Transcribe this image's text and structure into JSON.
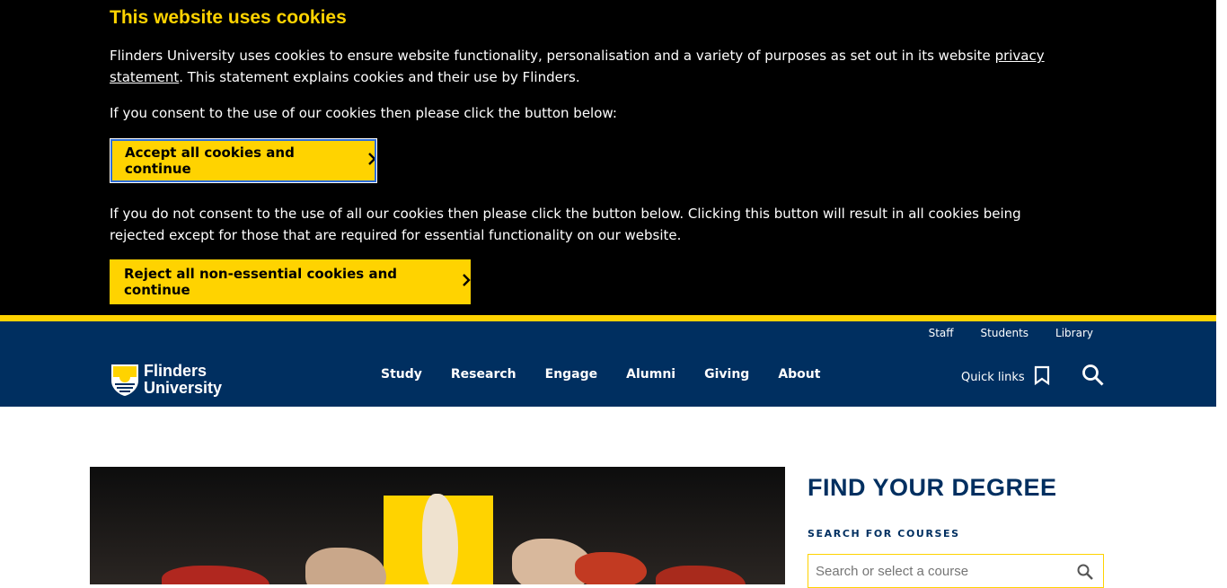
{
  "cookie": {
    "title": "This website uses cookies",
    "text1_before": "Flinders University uses cookies to ensure website functionality, personalisation and a variety of purposes as set out in its website ",
    "text1_link": "privacy statement",
    "text1_after": ". This statement explains cookies and their use by Flinders.",
    "text2": "If you consent to the use of our cookies then please click the button below:",
    "accept_label": "Accept all cookies and continue",
    "text3": "If you do not consent to the use of all our cookies then please click the button below. Clicking this button will result in all cookies being rejected except for those that are required for essential functionality on our website.",
    "reject_label": "Reject all non-essential cookies and continue"
  },
  "header": {
    "utility": [
      "Staff",
      "Students",
      "Library"
    ],
    "logo_line1": "Flinders",
    "logo_line2": "University",
    "nav": [
      "Study",
      "Research",
      "Engage",
      "Alumni",
      "Giving",
      "About"
    ],
    "quick_links": "Quick links"
  },
  "find": {
    "title": "FIND YOUR DEGREE",
    "label": "SEARCH FOR COURSES",
    "placeholder": "Search or select a course"
  },
  "colors": {
    "brand_yellow": "#ffd300",
    "brand_navy": "#002f60",
    "banner_bg": "#000000"
  },
  "icons": [
    "chevron-right-icon",
    "bookmark-icon",
    "search-icon"
  ]
}
